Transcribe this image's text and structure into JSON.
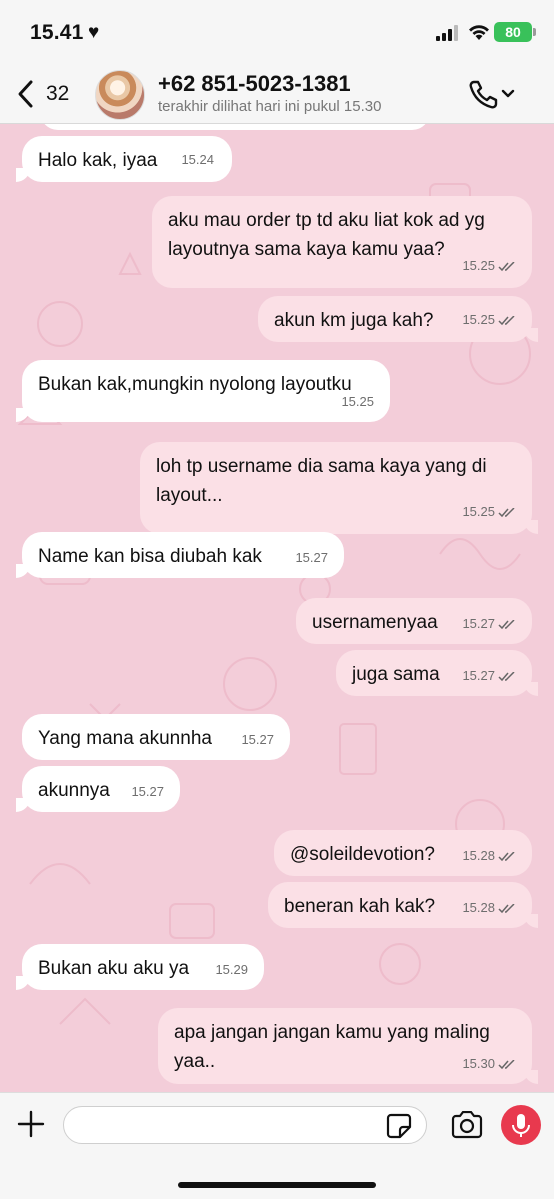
{
  "status_bar": {
    "time": "15.41",
    "battery": "80"
  },
  "header": {
    "back_count": "32",
    "contact_name": "+62 851-5023-1381",
    "last_seen": "terakhir dilihat hari ini pukul 15.30"
  },
  "messages": [
    {
      "dir": "in",
      "text": "Halo kak, iyaa",
      "time": "15.24"
    },
    {
      "dir": "out",
      "text": "aku mau order tp td aku liat kok ad yg layoutnya sama kaya kamu yaa?",
      "time": "15.25"
    },
    {
      "dir": "out",
      "text": "akun km juga kah?",
      "time": "15.25"
    },
    {
      "dir": "in",
      "text": "Bukan kak,mungkin nyolong layoutku",
      "time": "15.25"
    },
    {
      "dir": "out",
      "text": "loh tp username dia sama kaya yang di layout...",
      "time": "15.25"
    },
    {
      "dir": "in",
      "text": "Name kan bisa diubah kak",
      "time": "15.27"
    },
    {
      "dir": "out",
      "text": "usernamenyaa",
      "time": "15.27"
    },
    {
      "dir": "out",
      "text": "juga sama",
      "time": "15.27"
    },
    {
      "dir": "in",
      "text": "Yang mana akunnha",
      "time": "15.27"
    },
    {
      "dir": "in",
      "text": "akunnya",
      "time": "15.27"
    },
    {
      "dir": "out",
      "text": "@soleildevotion?",
      "time": "15.28"
    },
    {
      "dir": "out",
      "text": "beneran kah kak?",
      "time": "15.28"
    },
    {
      "dir": "in",
      "text": "Bukan aku aku ya",
      "time": "15.29"
    },
    {
      "dir": "out",
      "text": "apa jangan jangan kamu yang maling yaa..",
      "time": "15.30"
    }
  ],
  "input": {
    "value": "",
    "placeholder": ""
  },
  "colors": {
    "chat_background": "#f3cdd9",
    "incoming_bubble": "#ffffff",
    "outgoing_bubble": "#fbe0e6",
    "mic_button": "#e8394e",
    "battery": "#39c15a"
  },
  "icons": {
    "back": "chevron-left-icon",
    "call": "phone-icon",
    "plus": "plus-icon",
    "sticker": "sticker-icon",
    "camera": "camera-icon",
    "mic": "microphone-icon",
    "read_receipt": "double-check-icon"
  }
}
